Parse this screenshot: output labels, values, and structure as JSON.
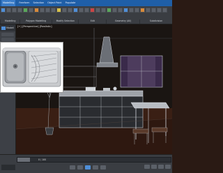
{
  "ribbon": {
    "tabs": [
      {
        "label": "Modelling"
      },
      {
        "label": "Freeform"
      },
      {
        "label": "Selection"
      },
      {
        "label": "Object Paint"
      },
      {
        "label": "Populate"
      }
    ],
    "groups": [
      {
        "label": "Modelling"
      },
      {
        "label": "Polygon Modelling"
      },
      {
        "label": "Modify Selection"
      },
      {
        "label": "Edit"
      },
      {
        "label": "Geometry (All)"
      },
      {
        "label": "Subdivision"
      }
    ]
  },
  "left_panel": {
    "title": "Modell"
  },
  "viewport": {
    "label": "[+] [Perspective] [Realistic]"
  },
  "timeline": {
    "frame": "0 / 100"
  },
  "colors": {
    "ribbon_blue": "#1f5fa8",
    "ui_gray": "#3a3d42",
    "wireframe": "#c8ccd2",
    "floor": "#3a1f14"
  }
}
